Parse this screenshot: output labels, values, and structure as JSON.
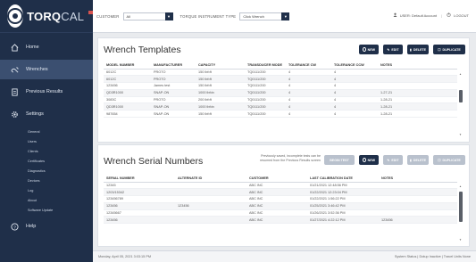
{
  "brand": {
    "name_bold": "TORQ",
    "name_light": "CAL",
    "badge_color": "#d9534f"
  },
  "sidebar": {
    "items": [
      {
        "label": "Home",
        "icon": "home-icon"
      },
      {
        "label": "Wrenches",
        "icon": "wrench-icon",
        "active": true
      },
      {
        "label": "Previous Results",
        "icon": "document-icon"
      },
      {
        "label": "Settings",
        "icon": "gear-icon"
      }
    ],
    "sub_items": [
      "General",
      "Users",
      "Clients",
      "Certificates",
      "Diagnostics",
      "Devices",
      "Log",
      "About",
      "Software Update"
    ],
    "help": {
      "label": "Help",
      "icon": "help-icon"
    }
  },
  "topbar": {
    "customer_label": "CUSTOMER",
    "customer_value": "All",
    "type_label": "TORQUE INSTRUMENT TYPE",
    "type_value": "Click Wrench",
    "user_text": "USER: Default Account",
    "logout": "LOGOUT"
  },
  "templates": {
    "title": "Wrench Templates",
    "buttons": [
      "NEW",
      "EDIT",
      "DELETE",
      "DUPLICATE"
    ],
    "columns": [
      "MODEL NUMBER",
      "MANUFACTURER",
      "CAPACITY",
      "TRANSDUCER MODE",
      "TOLERANCE CW",
      "TOLERANCE CCW",
      "NOTES"
    ],
    "rows": [
      [
        "6012C",
        "PROTO",
        "150 lbf•ft",
        "TQ0111/200",
        "4",
        "4",
        ""
      ],
      [
        "6012C",
        "PROTO",
        "150 lbf•ft",
        "TQ0111/200",
        "4",
        "4",
        ""
      ],
      [
        "123456",
        "James test",
        "150 lbf•ft",
        "TQ0111/200",
        "4",
        "4",
        ""
      ],
      [
        "QD3R1000",
        "SNAP-ON",
        "1000 lbf•in",
        "TQ0111/200",
        "4",
        "4",
        "1-27-21"
      ],
      [
        "3083C",
        "PROTO",
        "200 lbf•ft",
        "TQ0111/200",
        "4",
        "4",
        "1-28-21"
      ],
      [
        "QD3R1000",
        "SNAP-ON",
        "1000 lbf•in",
        "TQ0111/200",
        "4",
        "4",
        "1-28-21"
      ],
      [
        "987654",
        "SNAP-ON",
        "150 lbf•ft",
        "TQ0111/200",
        "4",
        "4",
        "1-28-21"
      ]
    ]
  },
  "serials": {
    "title": "Wrench Serial Numbers",
    "note_line1": "Previously saved, incomplete tests can be",
    "note_line2": "resumed from the Previous Results screen",
    "buttons": [
      "BEGIN TEST",
      "NEW",
      "EDIT",
      "DELETE",
      "DUPLICATE"
    ],
    "columns": [
      "SERIAL NUMBER",
      "ALTERNATE ID",
      "CUSTOMER",
      "LAST CALIBRATION DATE",
      "NOTES"
    ],
    "rows": [
      [
        "12345",
        "",
        "ABC INC",
        "01/21/2021 12:48:56 PM",
        ""
      ],
      [
        "1203/15342",
        "",
        "ABC INC",
        "01/22/2021 12:23:04 PM",
        ""
      ],
      [
        "123456789",
        "",
        "ABC INC",
        "01/22/2021 1:56:22 PM",
        ""
      ],
      [
        "123456",
        "123456",
        "ABC INC",
        "01/25/2021 3:46:42 PM",
        ""
      ],
      [
        "12345667",
        "",
        "ABC INC",
        "01/26/2021 3:52:36 PM",
        ""
      ],
      [
        "123456",
        "",
        "ABC INC",
        "01/27/2021 4:22:12 PM",
        "123456"
      ]
    ]
  },
  "status": {
    "datetime": "Monday, April 05, 2021 3:03:15 PM",
    "right": "System Status  |  Dotup Inactive  |  Travel Units None"
  }
}
